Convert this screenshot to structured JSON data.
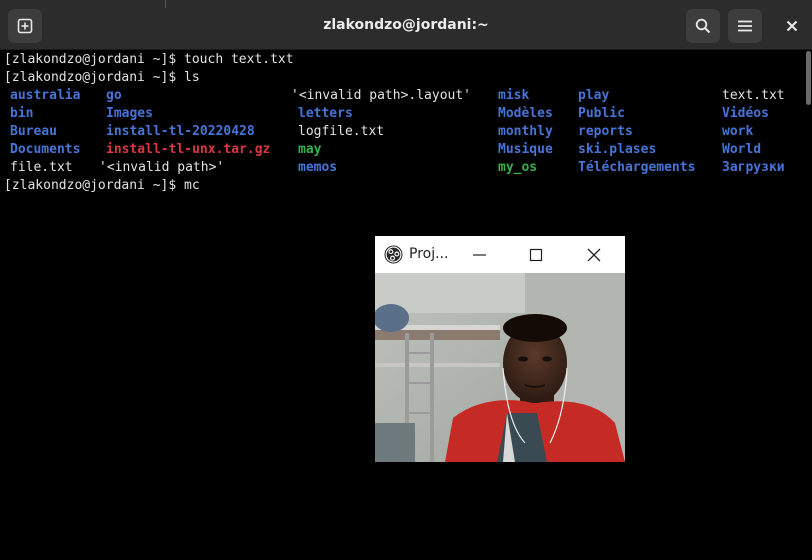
{
  "window": {
    "title": "zlakondzo@jordani:~"
  },
  "terminal": {
    "lines": [
      "[zlakondzo@jordani ~]$ touch text.txt",
      "[zlakondzo@jordani ~]$ ls",
      "[zlakondzo@jordani ~]$ mc"
    ],
    "ls_output": {
      "row1": [
        "australia",
        "go",
        "'<invalid path>.layout'",
        "misk",
        "play",
        "text.txt"
      ],
      "row2": [
        "bin",
        "Images",
        "letters",
        "Modèles",
        "Public",
        "Vidéos"
      ],
      "row3": [
        "Bureau",
        "install-tl-20220428",
        "logfile.txt",
        "monthly",
        "reports",
        "work"
      ],
      "row4": [
        "Documents",
        "install-tl-unx.tar.gz",
        "may",
        "Musique",
        "ski.plases",
        "World"
      ],
      "row5": [
        "file.txt",
        "'<invalid path>'",
        "memos",
        "my_os",
        "Téléchargements",
        "Загрузки"
      ]
    }
  },
  "projector": {
    "title": "Proj..."
  },
  "icons": {
    "new_tab": "new-tab-icon",
    "search": "search-icon",
    "menu": "hamburger-menu-icon",
    "close": "close-icon",
    "app": "obs-app-icon",
    "minimize": "minimize-icon",
    "maximize": "maximize-icon"
  },
  "colors": {
    "directory": "#4674d8",
    "archive": "#d8383f",
    "executable": "#34b24b",
    "text": "#e2e2e2",
    "header": "#2c2c2c"
  }
}
